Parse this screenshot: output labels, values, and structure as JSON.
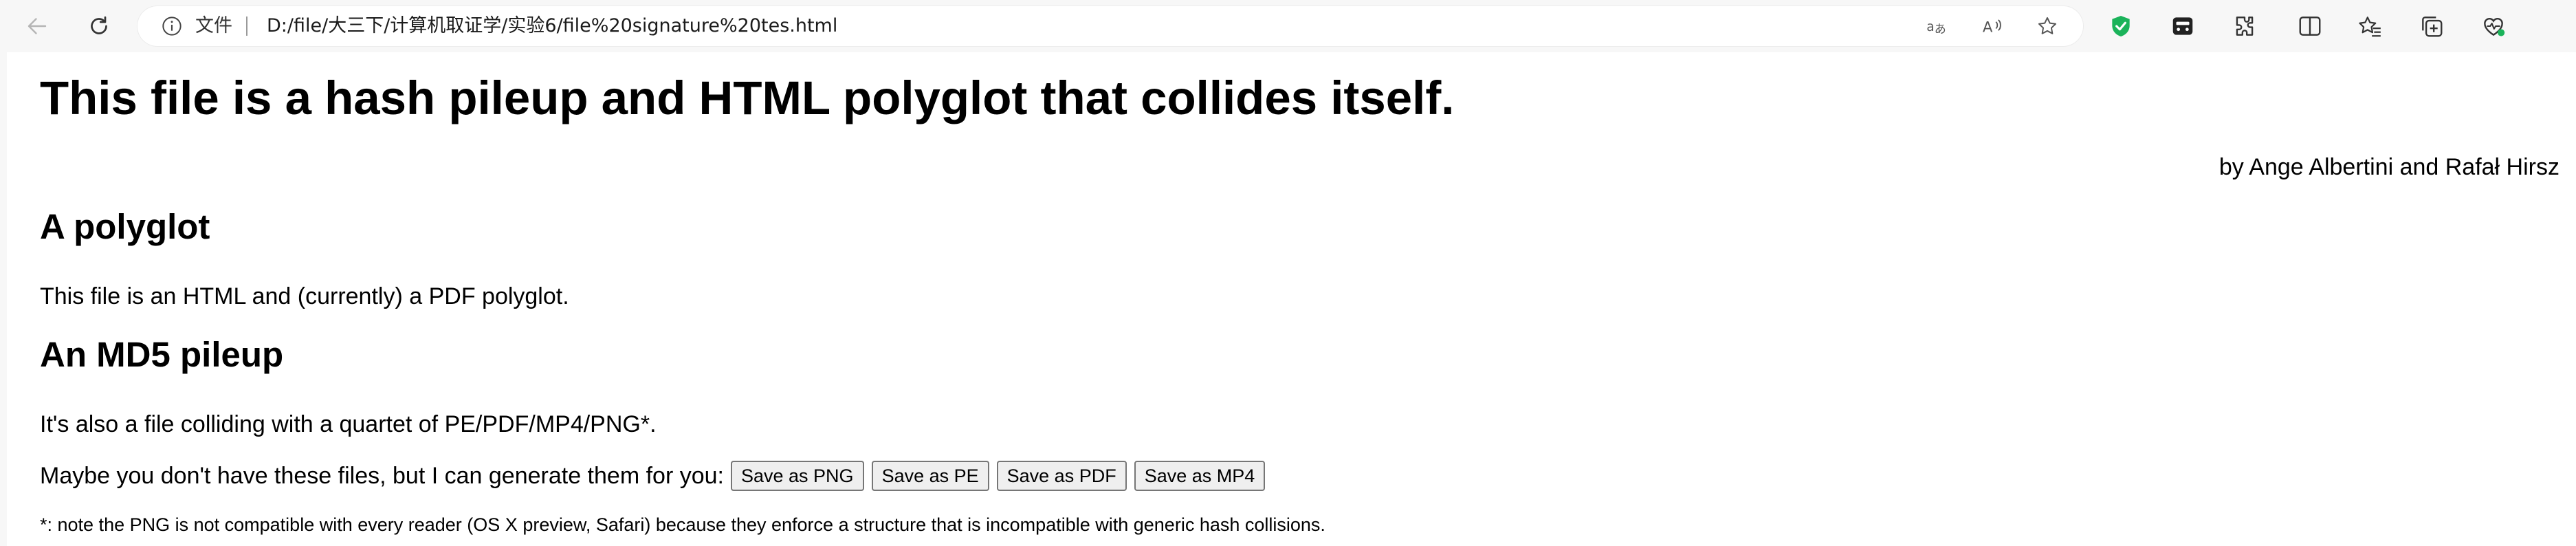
{
  "browser": {
    "site_label": "文件",
    "url": "D:/file/大三下/计算机取证学/实验6/file%20signature%20tes.html",
    "colors": {
      "toolbar_bg": "#f7f7f7",
      "shield_green": "#1bb35a"
    },
    "icons": [
      "back-arrow-icon",
      "refresh-icon",
      "info-icon",
      "read-aloud-translate-icon",
      "read-aloud-icon",
      "favorite-star-icon",
      "shield-icon",
      "sidebar-panel-icon",
      "extensions-icon",
      "split-screen-icon",
      "favorites-icon",
      "collections-icon",
      "browser-essentials-icon"
    ]
  },
  "page": {
    "title": "This file is a hash pileup and HTML polyglot that collides itself.",
    "byline": "by Ange Albertini and Rafał Hirsz",
    "polyglot": {
      "heading": "A polyglot",
      "text": "This file is an HTML and (currently) a PDF polyglot."
    },
    "pileup": {
      "heading": "An MD5 pileup",
      "text": "It's also a file colliding with a quartet of PE/PDF/MP4/PNG*.",
      "generate_text": "Maybe you don't have these files, but I can generate them for you:",
      "buttons": {
        "png": "Save as PNG",
        "pe": "Save as PE",
        "pdf": "Save as PDF",
        "mp4": "Save as MP4"
      }
    },
    "note": "*: note the PNG is not compatible with every reader (OS X preview, Safari) because they enforce a structure that is incompatible with generic hash collisions."
  }
}
